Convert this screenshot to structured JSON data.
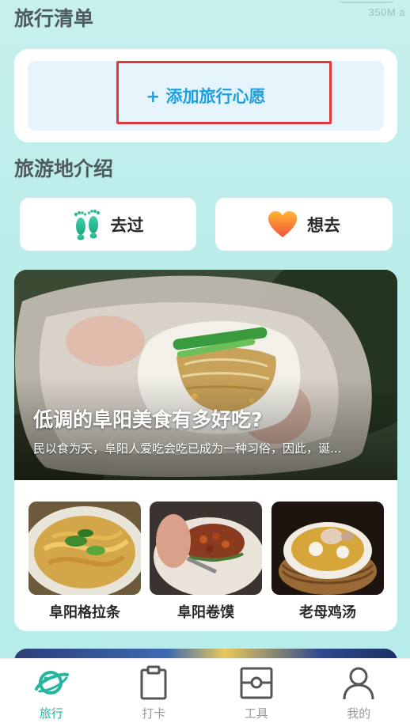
{
  "status_bar": {
    "ghost_text": "350M a"
  },
  "travel_list": {
    "title": "旅行清单",
    "add_wish_label": "+ 添加旅行心愿"
  },
  "destinations": {
    "title": "旅游地介绍",
    "been_label": "去过",
    "want_label": "想去",
    "feature": {
      "title": "低调的阜阳美食有多好吃?",
      "description": "民以食为天，阜阳人爱吃会吃已成为一种习俗，因此，诞..."
    },
    "dishes": [
      {
        "label": "阜阳格拉条"
      },
      {
        "label": "阜阳卷馍"
      },
      {
        "label": "老母鸡汤"
      }
    ]
  },
  "tabbar": {
    "items": [
      {
        "label": "旅行",
        "icon": "planet-icon",
        "active": true
      },
      {
        "label": "打卡",
        "icon": "clipboard-icon",
        "active": false
      },
      {
        "label": "工具",
        "icon": "toolbox-icon",
        "active": false
      },
      {
        "label": "我的",
        "icon": "profile-icon",
        "active": false
      }
    ]
  },
  "colors": {
    "accent": "#1ea0e0",
    "tab_active": "#25b5a0",
    "highlight_border": "#e0383a",
    "background": "#b9ecea"
  }
}
